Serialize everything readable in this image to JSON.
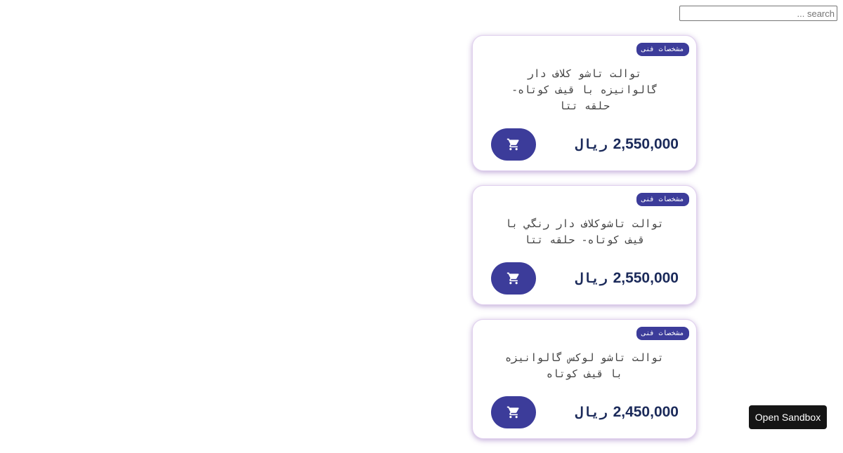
{
  "search": {
    "placeholder": "search ...",
    "value": ""
  },
  "products": [
    {
      "badge": "مشخصات فنی",
      "title": "توالت تاشو کلاف دار گالوانیزه با قیف کوتاه- حلقه تتا",
      "price": "2,550,000",
      "currency": "ریال"
    },
    {
      "badge": "مشخصات فنی",
      "title": "توالت تاشوکلاف دار رنگي با قیف کوتاه- حلقه تتا",
      "price": "2,550,000",
      "currency": "ریال"
    },
    {
      "badge": "مشخصات فنی",
      "title": "توالت تاشو لوکس گالوانیزه با قیف کوتاه",
      "price": "2,450,000",
      "currency": "ریال"
    }
  ],
  "sandbox": {
    "label": "Open Sandbox"
  },
  "icons": {
    "cart": "shopping-cart-icon"
  },
  "colors": {
    "accent": "#3c3c9a",
    "price_text": "#1b2a5a",
    "card_shadow": "#7846aa"
  }
}
